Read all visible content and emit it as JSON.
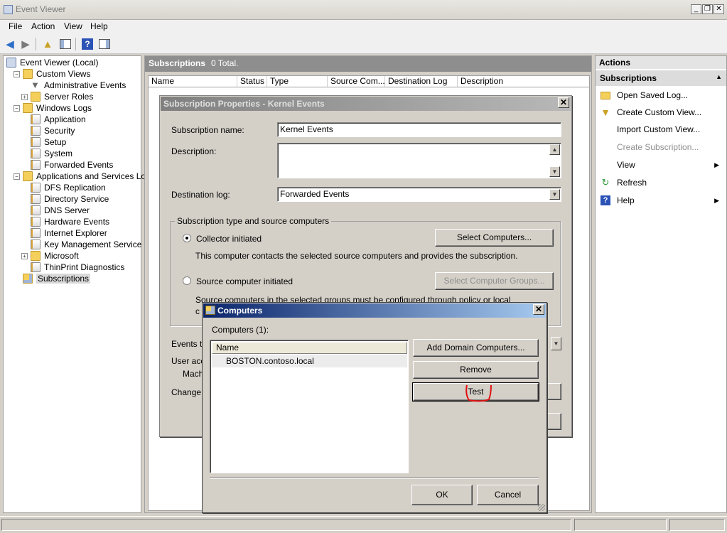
{
  "window": {
    "title": "Event Viewer"
  },
  "menu": [
    "File",
    "Action",
    "View",
    "Help"
  ],
  "tree": {
    "items": [
      {
        "label": "Event Viewer (Local)",
        "level": 0,
        "toggle": "",
        "icon": "root"
      },
      {
        "label": "Custom Views",
        "level": 1,
        "toggle": "−",
        "icon": "folder"
      },
      {
        "label": "Administrative Events",
        "level": 2,
        "toggle": "",
        "icon": "filter"
      },
      {
        "label": "Server Roles",
        "level": 2,
        "toggle": "+",
        "icon": "folder"
      },
      {
        "label": "Windows Logs",
        "level": 1,
        "toggle": "−",
        "icon": "folder"
      },
      {
        "label": "Application",
        "level": 2,
        "toggle": "",
        "icon": "log"
      },
      {
        "label": "Security",
        "level": 2,
        "toggle": "",
        "icon": "log"
      },
      {
        "label": "Setup",
        "level": 2,
        "toggle": "",
        "icon": "log"
      },
      {
        "label": "System",
        "level": 2,
        "toggle": "",
        "icon": "log"
      },
      {
        "label": "Forwarded Events",
        "level": 2,
        "toggle": "",
        "icon": "log"
      },
      {
        "label": "Applications and Services Logs",
        "level": 1,
        "toggle": "−",
        "icon": "folder"
      },
      {
        "label": "DFS Replication",
        "level": 2,
        "toggle": "",
        "icon": "log"
      },
      {
        "label": "Directory Service",
        "level": 2,
        "toggle": "",
        "icon": "log"
      },
      {
        "label": "DNS Server",
        "level": 2,
        "toggle": "",
        "icon": "log"
      },
      {
        "label": "Hardware Events",
        "level": 2,
        "toggle": "",
        "icon": "log"
      },
      {
        "label": "Internet Explorer",
        "level": 2,
        "toggle": "",
        "icon": "log"
      },
      {
        "label": "Key Management Service",
        "level": 2,
        "toggle": "",
        "icon": "log"
      },
      {
        "label": "Microsoft",
        "level": 2,
        "toggle": "+",
        "icon": "folder"
      },
      {
        "label": "ThinPrint Diagnostics",
        "level": 2,
        "toggle": "",
        "icon": "log"
      },
      {
        "label": "Subscriptions",
        "level": 1,
        "toggle": "",
        "icon": "subs",
        "selected": true
      }
    ]
  },
  "center": {
    "title": "Subscriptions",
    "count": "0 Total.",
    "columns": [
      "Name",
      "Status",
      "Type",
      "Source Com...",
      "Destination Log",
      "Description"
    ]
  },
  "actions": {
    "header": "Actions",
    "section": "Subscriptions",
    "items": [
      {
        "label": "Open Saved Log...",
        "icon": "open-folder-icon",
        "disabled": false,
        "submenu": false
      },
      {
        "label": "Create Custom View...",
        "icon": "filter-icon",
        "disabled": false,
        "submenu": false
      },
      {
        "label": "Import Custom View...",
        "icon": "",
        "disabled": false,
        "submenu": false
      },
      {
        "label": "Create Subscription...",
        "icon": "",
        "disabled": true,
        "submenu": false
      },
      {
        "label": "View",
        "icon": "",
        "disabled": false,
        "submenu": true
      },
      {
        "label": "Refresh",
        "icon": "refresh-icon",
        "disabled": false,
        "submenu": false
      },
      {
        "label": "Help",
        "icon": "help-icon",
        "disabled": false,
        "submenu": true
      }
    ]
  },
  "subscription_dialog": {
    "title": "Subscription Properties - Kernel Events",
    "name_label": "Subscription name:",
    "name_value": "Kernel Events",
    "description_label": "Description:",
    "description_value": "",
    "destination_label": "Destination log:",
    "destination_value": "Forwarded Events",
    "group_title": "Subscription type and source computers",
    "collector_label": "Collector initiated",
    "collector_desc": "This computer contacts the selected source computers and provides the subscription.",
    "select_computers_button": "Select Computers...",
    "source_label": "Source computer initiated",
    "source_desc_1": "Source computers in the selected groups must be configured through policy or local",
    "source_desc_2": "c",
    "select_groups_button": "Select Computer Groups...",
    "events_label": "Events t",
    "user_label": "User acc",
    "machine_label": "Mach",
    "change_label": "Change"
  },
  "computers_dialog": {
    "title": "Computers",
    "count_label": "Computers (1):",
    "column_name": "Name",
    "rows": [
      "BOSTON.contoso.local"
    ],
    "add_button": "Add Domain Computers...",
    "remove_button": "Remove",
    "test_button": "Test",
    "ok_button": "OK",
    "cancel_button": "Cancel"
  },
  "colors": {
    "active_title_start": "#0a246a",
    "active_title_end": "#a6caf0",
    "annotation_red": "#e01010"
  }
}
